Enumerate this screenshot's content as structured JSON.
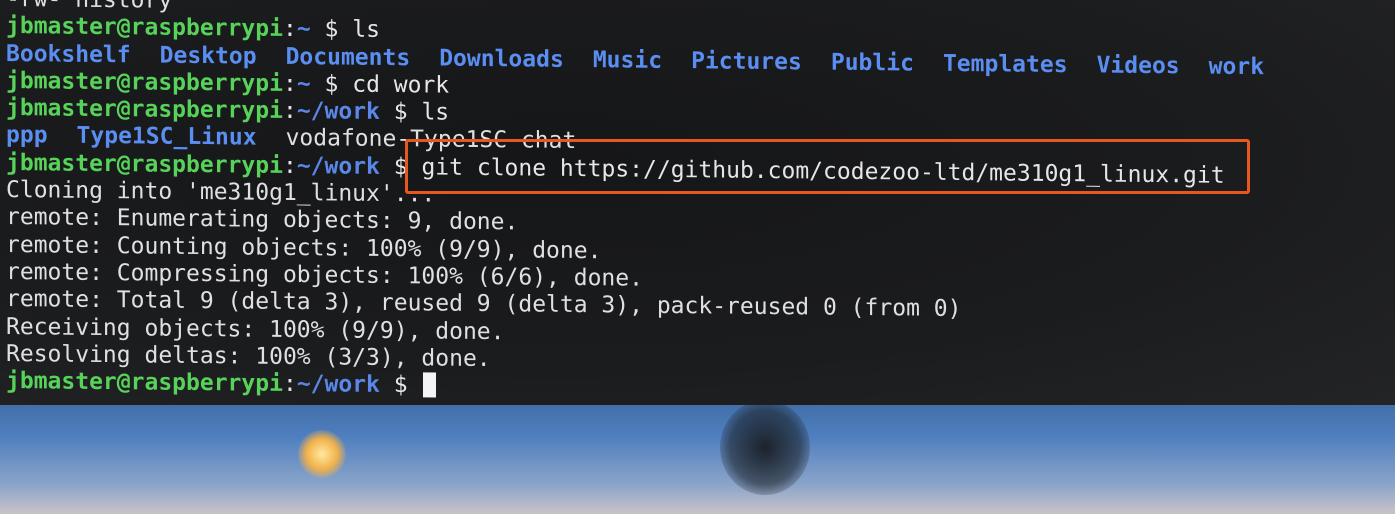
{
  "colors": {
    "prompt_user": "#57d35a",
    "prompt_path": "#5b87e8",
    "directory": "#5b8ef2",
    "text": "#e6e6e6",
    "highlight": "#e8571f",
    "background": "#1b1c1e"
  },
  "terminal": {
    "top_partial_line": "-rw- history",
    "prompt_user": "jbmaster@raspberrypi",
    "lines": [
      {
        "type": "prompt",
        "path": "~",
        "cmd": "ls"
      },
      {
        "type": "dirs",
        "items": [
          "Bookshelf",
          "Desktop",
          "Documents",
          "Downloads",
          "Music",
          "Pictures",
          "Public",
          "Templates",
          "Videos",
          "work"
        ]
      },
      {
        "type": "prompt",
        "path": "~",
        "cmd": "cd work"
      },
      {
        "type": "prompt",
        "path": "~/work",
        "cmd": "ls"
      },
      {
        "type": "mixed",
        "dirs": [
          "ppp",
          "Type1SC_Linux"
        ],
        "file": "vodafone-Type1SC-chat"
      },
      {
        "type": "prompt",
        "path": "~/work",
        "cmd": "git clone https://github.com/codezoo-ltd/me310g1_linux.git"
      },
      {
        "type": "output",
        "text": "Cloning into 'me310g1_linux'..."
      },
      {
        "type": "output",
        "text": "remote: Enumerating objects: 9, done."
      },
      {
        "type": "output",
        "text": "remote: Counting objects: 100% (9/9), done."
      },
      {
        "type": "output",
        "text": "remote: Compressing objects: 100% (6/6), done."
      },
      {
        "type": "output",
        "text": "remote: Total 9 (delta 3), reused 9 (delta 3), pack-reused 0 (from 0)"
      },
      {
        "type": "output",
        "text": "Receiving objects: 100% (9/9), done."
      },
      {
        "type": "output",
        "text": "Resolving deltas: 100% (3/3), done."
      },
      {
        "type": "prompt",
        "path": "~/work",
        "cmd": "",
        "cursor": true
      }
    ]
  }
}
